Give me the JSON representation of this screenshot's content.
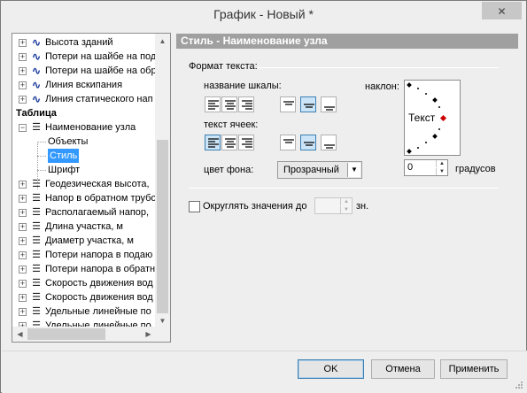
{
  "window": {
    "title": "График - Новый *"
  },
  "tree": {
    "items": [
      {
        "label": "Высота зданий",
        "icon": "wave-icon",
        "expander": "+"
      },
      {
        "label": "Потери на шайбе на под",
        "icon": "wave-icon",
        "expander": "+"
      },
      {
        "label": "Потери на шайбе на обр",
        "icon": "wave-icon",
        "expander": "+"
      },
      {
        "label": "Линия вскипания",
        "icon": "wave-icon",
        "expander": "+"
      },
      {
        "label": "Линия статического нап",
        "icon": "wave-icon",
        "expander": "+"
      },
      {
        "label": "Таблица",
        "icon": "",
        "expander": ""
      },
      {
        "label": "Наименование узла",
        "icon": "lines-icon",
        "expander": "−"
      },
      {
        "label": "Объекты",
        "icon": "",
        "expander": ""
      },
      {
        "label": "Стиль",
        "icon": "",
        "expander": ""
      },
      {
        "label": "Шрифт",
        "icon": "",
        "expander": ""
      },
      {
        "label": "Геодезическая высота,",
        "icon": "lines-icon",
        "expander": "+"
      },
      {
        "label": "Напор в обратном трубо",
        "icon": "lines-icon",
        "expander": "+"
      },
      {
        "label": "Располагаемый напор,",
        "icon": "lines-icon",
        "expander": "+"
      },
      {
        "label": "Длина участка, м",
        "icon": "lines-icon",
        "expander": "+"
      },
      {
        "label": "Диаметр участка, м",
        "icon": "lines-icon",
        "expander": "+"
      },
      {
        "label": "Потери напора в подаю",
        "icon": "lines-icon",
        "expander": "+"
      },
      {
        "label": "Потери напора в обратн",
        "icon": "lines-icon",
        "expander": "+"
      },
      {
        "label": "Скорость движения вод",
        "icon": "lines-icon",
        "expander": "+"
      },
      {
        "label": "Скорость движения вод",
        "icon": "lines-icon",
        "expander": "+"
      },
      {
        "label": "Удельные линейные по",
        "icon": "lines-icon",
        "expander": "+"
      },
      {
        "label": "Удельные линейные по",
        "icon": "lines-icon",
        "expander": "+"
      }
    ]
  },
  "panel": {
    "header": "Стиль - Наименование узла",
    "format_group": "Формат текста:",
    "scale_name_label": "название шкалы:",
    "cell_text_label": "текст ячеек:",
    "tilt_label": "наклон:",
    "preview_text": "Текст",
    "degrees_value": "0",
    "degrees_label": "градусов",
    "bg_color_label": "цвет фона:",
    "bg_color_value": "Прозрачный",
    "round_label": "Округлять значения до",
    "round_value": "",
    "round_suffix": "зн."
  },
  "buttons": {
    "ok": "OK",
    "cancel": "Отмена",
    "apply": "Применить"
  },
  "colors": {
    "header_bg": "#a0a0a0",
    "selected": "#3399ff",
    "preview_marker": "#cc0000"
  }
}
